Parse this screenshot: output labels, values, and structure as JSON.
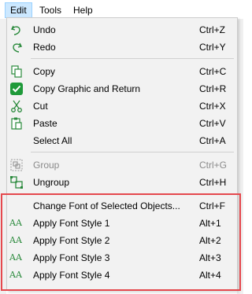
{
  "menubar": {
    "items": [
      "Edit",
      "Tools",
      "Help"
    ]
  },
  "menu": {
    "items": [
      {
        "label": "Undo",
        "shortcut": "Ctrl+Z",
        "icon": "undo-icon",
        "enabled": true
      },
      {
        "label": "Redo",
        "shortcut": "Ctrl+Y",
        "icon": "redo-icon",
        "enabled": true
      },
      {
        "label": "Copy",
        "shortcut": "Ctrl+C",
        "icon": "copy-icon",
        "enabled": true
      },
      {
        "label": "Copy Graphic and Return",
        "shortcut": "Ctrl+R",
        "icon": "check-icon",
        "enabled": true
      },
      {
        "label": "Cut",
        "shortcut": "Ctrl+X",
        "icon": "scissors-icon",
        "enabled": true
      },
      {
        "label": "Paste",
        "shortcut": "Ctrl+V",
        "icon": "paste-icon",
        "enabled": true
      },
      {
        "label": "Select All",
        "shortcut": "Ctrl+A",
        "icon": "",
        "enabled": true
      },
      {
        "label": "Group",
        "shortcut": "Ctrl+G",
        "icon": "group-icon",
        "enabled": false
      },
      {
        "label": "Ungroup",
        "shortcut": "Ctrl+H",
        "icon": "ungroup-icon",
        "enabled": true
      },
      {
        "label": "Change Font of Selected Objects...",
        "shortcut": "Ctrl+F",
        "icon": "",
        "enabled": true
      },
      {
        "label": "Apply Font Style 1",
        "shortcut": "Alt+1",
        "icon": "font-style-icon",
        "enabled": true
      },
      {
        "label": "Apply Font Style 2",
        "shortcut": "Alt+2",
        "icon": "font-style-icon",
        "enabled": true
      },
      {
        "label": "Apply Font Style 3",
        "shortcut": "Alt+3",
        "icon": "font-style-icon",
        "enabled": true
      },
      {
        "label": "Apply Font Style 4",
        "shortcut": "Alt+4",
        "icon": "font-style-icon",
        "enabled": true
      }
    ]
  },
  "font_style_icon_glyph": "AA",
  "colors": {
    "accent_green": "#2a8a3c",
    "highlight_red": "#e5484d",
    "menu_bg": "#f2f2f2"
  }
}
